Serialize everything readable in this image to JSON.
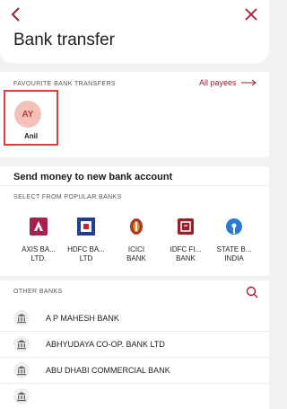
{
  "header": {
    "title": "Bank transfer",
    "back_icon": "chevron-left-icon",
    "close_icon": "close-icon",
    "accent_color": "#9b1b2f"
  },
  "favourites": {
    "section_title": "FAVOURITE BANK TRANSFERS",
    "all_payees_label": "All payees",
    "payees": [
      {
        "initials": "AY",
        "name": "Anil"
      }
    ]
  },
  "new_account": {
    "title": "Send money to new bank account",
    "popular_title": "SELECT FROM POPULAR BANKS",
    "banks": [
      {
        "name": "AXIS BA...\nLTD.",
        "icon": "axis-bank-icon",
        "color": "#a6214b"
      },
      {
        "name": "HDFC BA...\nLTD",
        "icon": "hdfc-bank-icon",
        "color": "#1f3f8f"
      },
      {
        "name": "ICICI\nBANK",
        "icon": "icici-bank-icon",
        "color": "#b13a20"
      },
      {
        "name": "IDFC FI...\nBANK",
        "icon": "idfc-bank-icon",
        "color": "#9b1d25"
      },
      {
        "name": "STATE B...\nINDIA",
        "icon": "sbi-bank-icon",
        "color": "#2a7bd6"
      }
    ]
  },
  "other_banks": {
    "title": "OTHER BANKS",
    "search_icon": "search-icon",
    "items": [
      {
        "label": "A P MAHESH BANK",
        "icon": "bank-building-icon"
      },
      {
        "label": "ABHYUDAYA CO-OP. BANK LTD",
        "icon": "bank-building-icon"
      },
      {
        "label": "ABU DHABI COMMERCIAL BANK",
        "icon": "bank-building-icon"
      }
    ]
  }
}
